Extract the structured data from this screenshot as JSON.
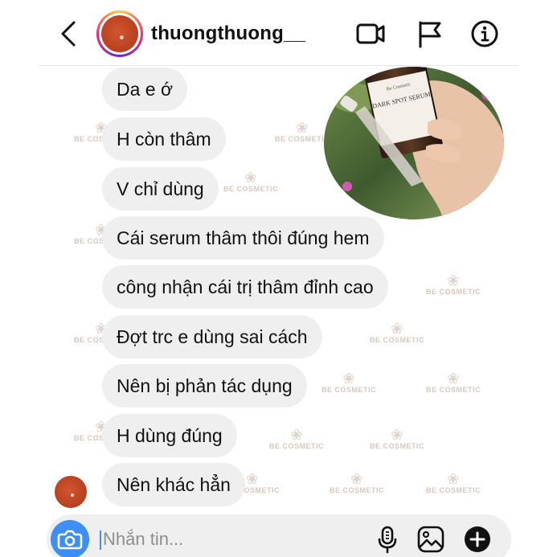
{
  "header": {
    "username": "thuongthuong__"
  },
  "messages": [
    "Da e ớ",
    "H còn thâm",
    "V chỉ dùng",
    "Cái serum thâm thôi đúng hem",
    "công nhận cái trị thâm đỉnh cao",
    "Đợt trc e dùng sai cách",
    "Nên bị phản tác dụng",
    "H dùng đúng",
    "Nên khác hẳn"
  ],
  "product_photo": {
    "brand_text": "Be Cosmetic",
    "product_text": "DARK SPOT SERUM"
  },
  "watermark": {
    "text": "BE COSMETIC"
  },
  "composer": {
    "placeholder": "Nhắn tin..."
  },
  "icons": {
    "back": "chevron-left-icon",
    "video": "video-camera-icon",
    "flag": "flag-icon",
    "info": "info-icon",
    "camera": "camera-icon",
    "mic": "microphone-icon",
    "gallery": "image-icon",
    "add": "plus-circle-icon"
  },
  "colors": {
    "accent": "#3e8ef7",
    "bubble": "#efefef",
    "text": "#111111"
  }
}
